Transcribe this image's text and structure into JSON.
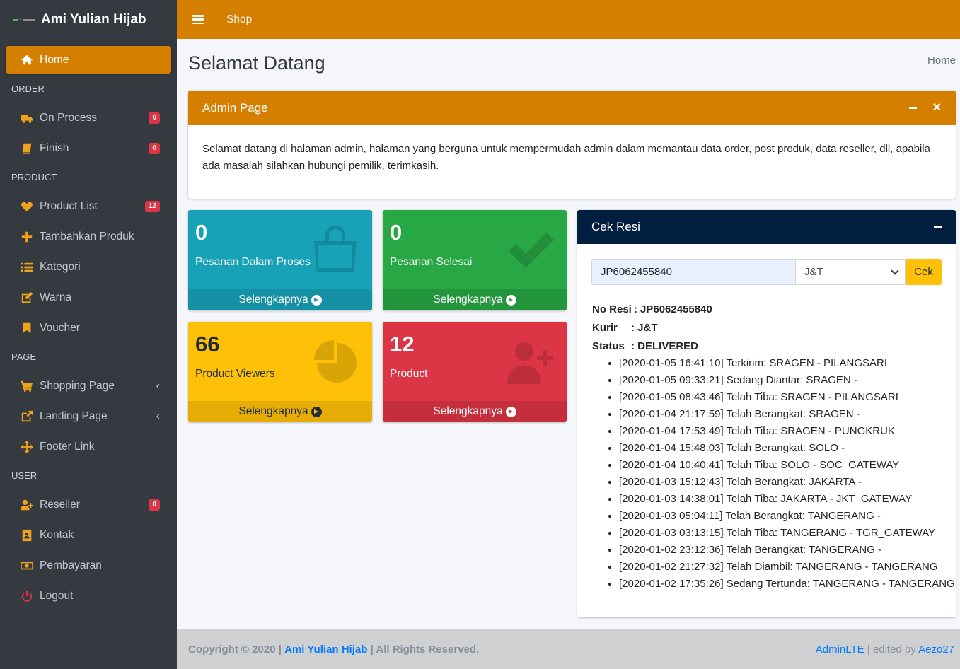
{
  "brand": {
    "name": "Ami Yulian Hijab"
  },
  "topbar": {
    "menu_link": "Shop"
  },
  "sidebar": {
    "home": "Home",
    "headers": {
      "order": "ORDER",
      "product": "PRODUCT",
      "page": "PAGE",
      "user": "USER"
    },
    "on_process": {
      "label": "On Process",
      "badge": "0"
    },
    "finish": {
      "label": "Finish",
      "badge": "0"
    },
    "product_list": {
      "label": "Product List",
      "badge": "12"
    },
    "tambahkan_produk": "Tambahkan Produk",
    "kategori": "Kategori",
    "warna": "Warna",
    "voucher": "Voucher",
    "shopping_page": "Shopping Page",
    "landing_page": "Landing Page",
    "footer_link": "Footer Link",
    "reseller": {
      "label": "Reseller",
      "badge": "0"
    },
    "kontak": "Kontak",
    "pembayaran": "Pembayaran",
    "logout": "Logout"
  },
  "content": {
    "title": "Selamat Datang",
    "breadcrumb": "Home"
  },
  "admin_card": {
    "title": "Admin Page",
    "body": "Selamat datang di halaman admin, halaman yang berguna untuk mempermudah admin dalam memantau data order, post produk, data reseller, dll, apabila ada masalah silahkan hubungi pemilik, terimkasih."
  },
  "boxes": {
    "pesanan_proses": {
      "value": "0",
      "label": "Pesanan Dalam Proses",
      "link": "Selengkapnya"
    },
    "pesanan_selesai": {
      "value": "0",
      "label": "Pesanan Selesai",
      "link": "Selengkapnya"
    },
    "product_viewers": {
      "value": "66",
      "label": "Product Viewers",
      "link": "Selengkapnya"
    },
    "product": {
      "value": "12",
      "label": "Product",
      "link": "Selengkapnya"
    }
  },
  "cek_resi": {
    "title": "Cek Resi",
    "input_value": "JP6062455840",
    "courier_selected": "J&T",
    "button": "Cek",
    "no_resi_label": "No Resi",
    "no_resi_value": ": JP6062455840",
    "kurir_label": "Kurir",
    "kurir_value": ": J&T",
    "status_label": "Status",
    "status_value": ": DELIVERED",
    "history": [
      "[2020-01-05 16:41:10] Terkirim: SRAGEN - PILANGSARI",
      "[2020-01-05 09:33:21] Sedang Diantar: SRAGEN -",
      "[2020-01-05 08:43:46] Telah Tiba: SRAGEN - PILANGSARI",
      "[2020-01-04 21:17:59] Telah Berangkat: SRAGEN -",
      "[2020-01-04 17:53:49] Telah Tiba: SRAGEN - PUNGKRUK",
      "[2020-01-04 15:48:03] Telah Berangkat: SOLO -",
      "[2020-01-04 10:40:41] Telah Tiba: SOLO - SOC_GATEWAY",
      "[2020-01-03 15:12:43] Telah Berangkat: JAKARTA -",
      "[2020-01-03 14:38:01] Telah Tiba: JAKARTA - JKT_GATEWAY",
      "[2020-01-03 05:04:11] Telah Berangkat: TANGERANG -",
      "[2020-01-03 03:13:15] Telah Tiba: TANGERANG - TGR_GATEWAY",
      "[2020-01-02 23:12:36] Telah Berangkat: TANGERANG -",
      "[2020-01-02 21:27:32] Telah Diambil: TANGERANG - TANGERANG",
      "[2020-01-02 17:35:26] Sedang Tertunda: TANGERANG - TANGERANG"
    ]
  },
  "footer": {
    "copyright": "Copyright © 2020 |",
    "brand_link": "Ami Yulian Hijab",
    "rights": "| All Rights Reserved.",
    "adminlte_link": "AdminLTE",
    "edited_by": "| edited by",
    "author_link": "Aezo27"
  },
  "colors": {
    "primary": "#d47f00",
    "sidebar": "#343a40",
    "teal": "#17a2b8",
    "green": "#28a745",
    "yellow": "#ffc107",
    "red": "#dc3545",
    "navy": "#001f3f"
  }
}
